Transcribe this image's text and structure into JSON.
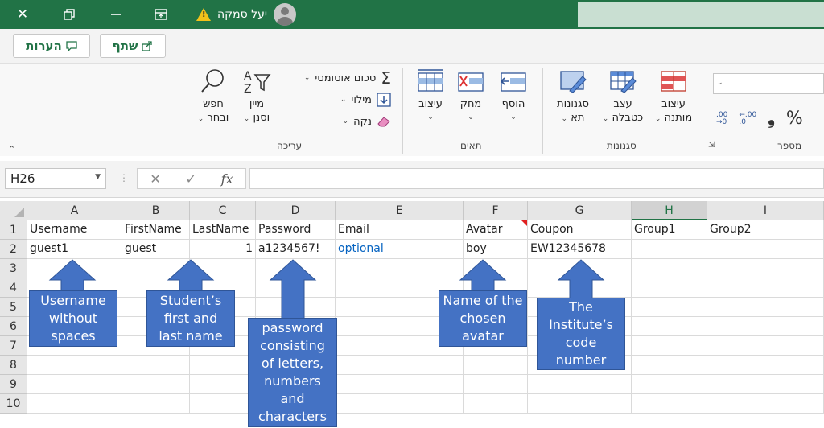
{
  "titlebar": {
    "user_name": "יעל סמקה"
  },
  "ribbon": {
    "share_label": "שתף",
    "comments_label": "הערות",
    "editing": {
      "group_label": "עריכה",
      "autosum_label": "סכום אוטומטי",
      "fill_label": "מילוי",
      "clear_label": "נקה",
      "sort_label_1": "מיין",
      "sort_label_2": "וסנן",
      "find_label_1": "חפש",
      "find_label_2": "ובחר"
    },
    "cells": {
      "group_label": "תאים",
      "format_label": "עיצוב",
      "delete_label": "מחק",
      "insert_label": "הוסף"
    },
    "styles": {
      "group_label": "סגנונות",
      "cell_styles_1": "סגנונות",
      "cell_styles_2": "תא",
      "format_table_1": "עצב",
      "format_table_2": "כטבלה",
      "conditional_1": "עיצוב",
      "conditional_2": "מותנה"
    },
    "number": {
      "group_label": "מספר",
      "percent": "%",
      "comma": "❟",
      "inc_decimal": ".00",
      "dec_decimal": ".00"
    }
  },
  "formula_bar": {
    "name_box": "H26",
    "fx": "fx",
    "cancel": "✕",
    "enter": "✓"
  },
  "grid": {
    "columns": [
      "A",
      "B",
      "C",
      "D",
      "E",
      "F",
      "G",
      "H",
      "I"
    ],
    "rows": [
      "1",
      "2",
      "3",
      "4",
      "5",
      "6",
      "7",
      "8",
      "9",
      "10"
    ],
    "row1": [
      "Username",
      "FirstName",
      "LastName",
      "Password",
      "Email",
      "Avatar",
      "Coupon",
      "Group1",
      "Group2"
    ],
    "row2": [
      "guest1",
      "guest",
      "1",
      "a1234567!",
      "optional",
      "boy",
      "EW12345678",
      "",
      ""
    ]
  },
  "callouts": {
    "username": "Username without spaces",
    "student": "Student’s first and last name",
    "password": "password consisting of letters, numbers and characters",
    "avatar": "Name of the chosen avatar",
    "coupon": "The Institute’s code number"
  },
  "colors": {
    "excel_green": "#217346",
    "callout_blue": "#4472c4",
    "link_blue": "#0563c1"
  }
}
